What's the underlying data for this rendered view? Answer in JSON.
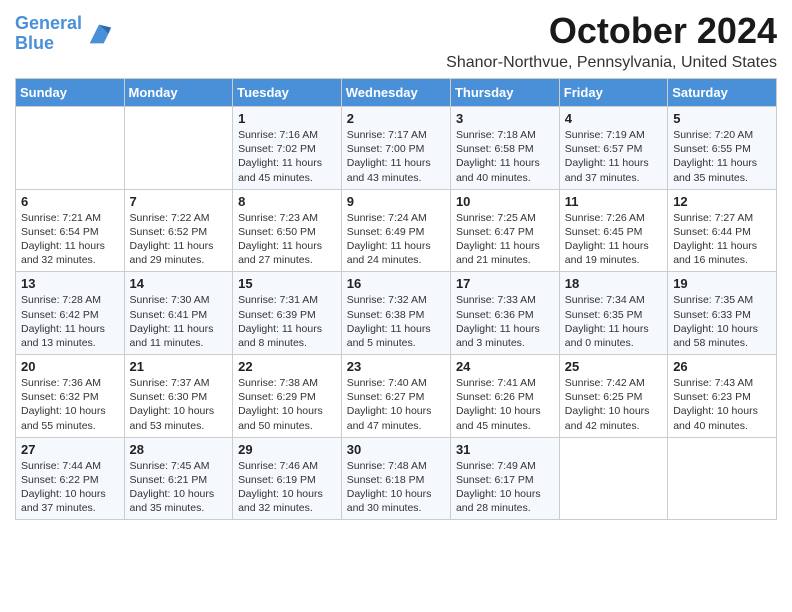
{
  "header": {
    "logo_line1": "General",
    "logo_line2": "Blue",
    "month": "October 2024",
    "location": "Shanor-Northvue, Pennsylvania, United States"
  },
  "days_of_week": [
    "Sunday",
    "Monday",
    "Tuesday",
    "Wednesday",
    "Thursday",
    "Friday",
    "Saturday"
  ],
  "weeks": [
    [
      {
        "day": "",
        "info": ""
      },
      {
        "day": "",
        "info": ""
      },
      {
        "day": "1",
        "info": "Sunrise: 7:16 AM\nSunset: 7:02 PM\nDaylight: 11 hours and 45 minutes."
      },
      {
        "day": "2",
        "info": "Sunrise: 7:17 AM\nSunset: 7:00 PM\nDaylight: 11 hours and 43 minutes."
      },
      {
        "day": "3",
        "info": "Sunrise: 7:18 AM\nSunset: 6:58 PM\nDaylight: 11 hours and 40 minutes."
      },
      {
        "day": "4",
        "info": "Sunrise: 7:19 AM\nSunset: 6:57 PM\nDaylight: 11 hours and 37 minutes."
      },
      {
        "day": "5",
        "info": "Sunrise: 7:20 AM\nSunset: 6:55 PM\nDaylight: 11 hours and 35 minutes."
      }
    ],
    [
      {
        "day": "6",
        "info": "Sunrise: 7:21 AM\nSunset: 6:54 PM\nDaylight: 11 hours and 32 minutes."
      },
      {
        "day": "7",
        "info": "Sunrise: 7:22 AM\nSunset: 6:52 PM\nDaylight: 11 hours and 29 minutes."
      },
      {
        "day": "8",
        "info": "Sunrise: 7:23 AM\nSunset: 6:50 PM\nDaylight: 11 hours and 27 minutes."
      },
      {
        "day": "9",
        "info": "Sunrise: 7:24 AM\nSunset: 6:49 PM\nDaylight: 11 hours and 24 minutes."
      },
      {
        "day": "10",
        "info": "Sunrise: 7:25 AM\nSunset: 6:47 PM\nDaylight: 11 hours and 21 minutes."
      },
      {
        "day": "11",
        "info": "Sunrise: 7:26 AM\nSunset: 6:45 PM\nDaylight: 11 hours and 19 minutes."
      },
      {
        "day": "12",
        "info": "Sunrise: 7:27 AM\nSunset: 6:44 PM\nDaylight: 11 hours and 16 minutes."
      }
    ],
    [
      {
        "day": "13",
        "info": "Sunrise: 7:28 AM\nSunset: 6:42 PM\nDaylight: 11 hours and 13 minutes."
      },
      {
        "day": "14",
        "info": "Sunrise: 7:30 AM\nSunset: 6:41 PM\nDaylight: 11 hours and 11 minutes."
      },
      {
        "day": "15",
        "info": "Sunrise: 7:31 AM\nSunset: 6:39 PM\nDaylight: 11 hours and 8 minutes."
      },
      {
        "day": "16",
        "info": "Sunrise: 7:32 AM\nSunset: 6:38 PM\nDaylight: 11 hours and 5 minutes."
      },
      {
        "day": "17",
        "info": "Sunrise: 7:33 AM\nSunset: 6:36 PM\nDaylight: 11 hours and 3 minutes."
      },
      {
        "day": "18",
        "info": "Sunrise: 7:34 AM\nSunset: 6:35 PM\nDaylight: 11 hours and 0 minutes."
      },
      {
        "day": "19",
        "info": "Sunrise: 7:35 AM\nSunset: 6:33 PM\nDaylight: 10 hours and 58 minutes."
      }
    ],
    [
      {
        "day": "20",
        "info": "Sunrise: 7:36 AM\nSunset: 6:32 PM\nDaylight: 10 hours and 55 minutes."
      },
      {
        "day": "21",
        "info": "Sunrise: 7:37 AM\nSunset: 6:30 PM\nDaylight: 10 hours and 53 minutes."
      },
      {
        "day": "22",
        "info": "Sunrise: 7:38 AM\nSunset: 6:29 PM\nDaylight: 10 hours and 50 minutes."
      },
      {
        "day": "23",
        "info": "Sunrise: 7:40 AM\nSunset: 6:27 PM\nDaylight: 10 hours and 47 minutes."
      },
      {
        "day": "24",
        "info": "Sunrise: 7:41 AM\nSunset: 6:26 PM\nDaylight: 10 hours and 45 minutes."
      },
      {
        "day": "25",
        "info": "Sunrise: 7:42 AM\nSunset: 6:25 PM\nDaylight: 10 hours and 42 minutes."
      },
      {
        "day": "26",
        "info": "Sunrise: 7:43 AM\nSunset: 6:23 PM\nDaylight: 10 hours and 40 minutes."
      }
    ],
    [
      {
        "day": "27",
        "info": "Sunrise: 7:44 AM\nSunset: 6:22 PM\nDaylight: 10 hours and 37 minutes."
      },
      {
        "day": "28",
        "info": "Sunrise: 7:45 AM\nSunset: 6:21 PM\nDaylight: 10 hours and 35 minutes."
      },
      {
        "day": "29",
        "info": "Sunrise: 7:46 AM\nSunset: 6:19 PM\nDaylight: 10 hours and 32 minutes."
      },
      {
        "day": "30",
        "info": "Sunrise: 7:48 AM\nSunset: 6:18 PM\nDaylight: 10 hours and 30 minutes."
      },
      {
        "day": "31",
        "info": "Sunrise: 7:49 AM\nSunset: 6:17 PM\nDaylight: 10 hours and 28 minutes."
      },
      {
        "day": "",
        "info": ""
      },
      {
        "day": "",
        "info": ""
      }
    ]
  ]
}
